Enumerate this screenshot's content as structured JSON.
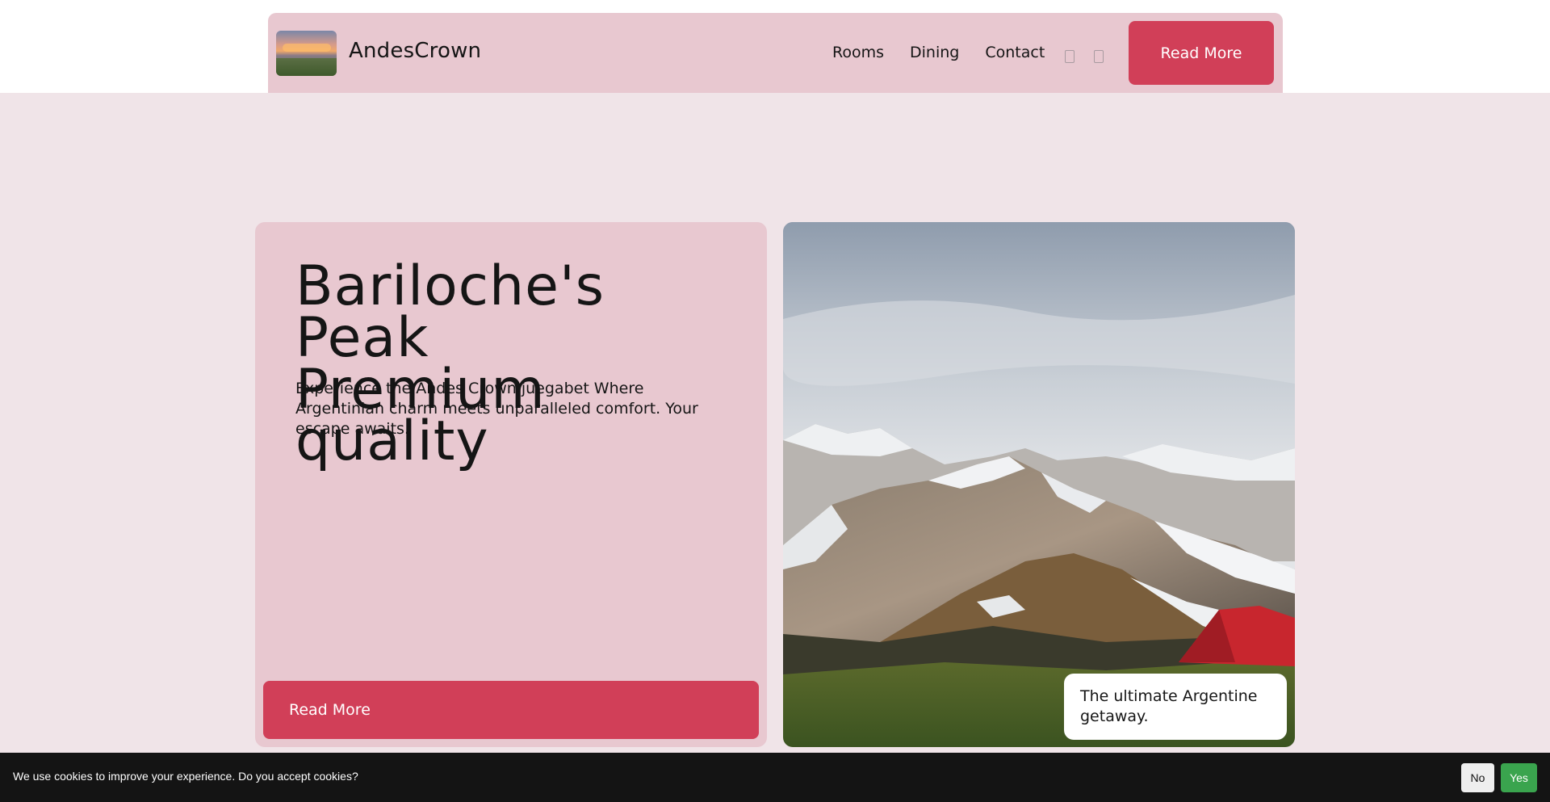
{
  "header": {
    "brand": "AndesCrown",
    "nav": [
      "Rooms",
      "Dining",
      "Contact"
    ],
    "cta_label": "Read More",
    "icons": [
      "social-icon-1",
      "social-icon-2"
    ]
  },
  "hero": {
    "title_line1": "Bariloche's Peak",
    "title_line2": "Premium quality",
    "subtitle": "Experience the Andes Crown.juegabet Where Argentinian charm meets unparalleled comfort. Your escape awaits.",
    "button_label": "Read More"
  },
  "photo": {
    "caption": "The ultimate Argentine getaway."
  },
  "cookie": {
    "message": "We use cookies to improve your experience. Do you accept cookies?",
    "no_label": "No",
    "yes_label": "Yes"
  },
  "colors": {
    "accent": "#d13f58",
    "card_bg": "#e8c8d0",
    "page_bg": "#f0e4e8",
    "cookie_bg": "#141414",
    "yes_green": "#3aa44e"
  }
}
